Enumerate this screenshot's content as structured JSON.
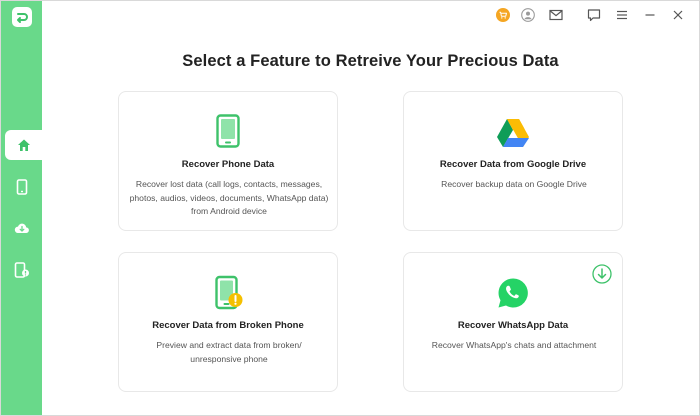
{
  "heading": "Select a Feature to Retreive Your Precious Data",
  "colors": {
    "sidebar": "#69d98a",
    "accent": "#3ec26a",
    "cart": "#f5a623"
  },
  "sidebar": {
    "items": [
      {
        "icon": "home-icon",
        "active": true
      },
      {
        "icon": "phone-icon",
        "active": false
      },
      {
        "icon": "cloud-icon",
        "active": false
      },
      {
        "icon": "broken-phone-icon",
        "active": false
      }
    ]
  },
  "titlebar": {
    "icons": [
      "cart-icon",
      "account-icon",
      "mail-icon",
      "feedback-icon",
      "menu-icon",
      "minimize-icon",
      "close-icon"
    ]
  },
  "cards": [
    {
      "title": "Recover Phone Data",
      "desc": "Recover lost data (call logs, contacts, messages, photos, audios, videos, documents, WhatsApp data) from Android device",
      "icon": "phone-icon"
    },
    {
      "title": "Recover Data from Google Drive",
      "desc": "Recover backup data on Google Drive",
      "icon": "google-drive-icon"
    },
    {
      "title": "Recover Data from Broken Phone",
      "desc": "Preview and extract data from broken/ unresponsive phone",
      "icon": "broken-phone-icon"
    },
    {
      "title": "Recover WhatsApp Data",
      "desc": "Recover WhatsApp's chats and attachment",
      "icon": "whatsapp-icon"
    }
  ]
}
